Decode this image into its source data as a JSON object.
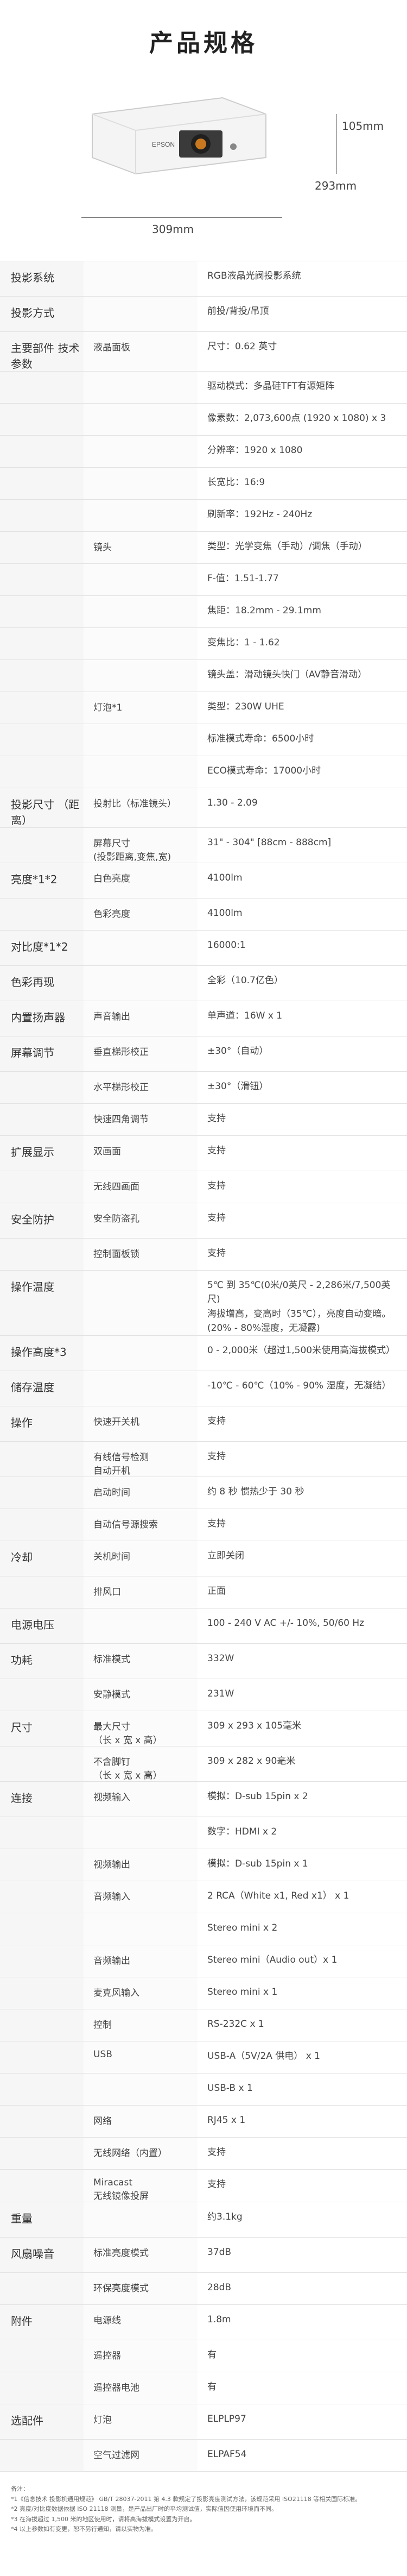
{
  "page_title": "产品规格",
  "brand": "EPSON",
  "dims": {
    "height": "105mm",
    "depth": "293mm",
    "width": "309mm"
  },
  "rows": [
    {
      "cat": "投影系统",
      "sub": "",
      "val": "RGB液晶光阀投影系统"
    },
    {
      "cat": "投影方式",
      "sub": "",
      "val": "前投/背投/吊顶"
    },
    {
      "cat": "主要部件\n技术参数",
      "sub": "液晶面板",
      "val": "尺寸：0.62 英寸"
    },
    {
      "cat": "",
      "sub": "",
      "val": "驱动模式：多晶硅TFT有源矩阵"
    },
    {
      "cat": "",
      "sub": "",
      "val": "像素数：2,073,600点 (1920 x 1080) x 3"
    },
    {
      "cat": "",
      "sub": "",
      "val": "分辨率：1920 x 1080"
    },
    {
      "cat": "",
      "sub": "",
      "val": "长宽比：16:9"
    },
    {
      "cat": "",
      "sub": "",
      "val": "刷新率：192Hz - 240Hz"
    },
    {
      "cat": "",
      "sub": "镜头",
      "val": "类型：光学变焦（手动）/调焦（手动）"
    },
    {
      "cat": "",
      "sub": "",
      "val": "F-值：1.51-1.77"
    },
    {
      "cat": "",
      "sub": "",
      "val": "焦距：18.2mm - 29.1mm"
    },
    {
      "cat": "",
      "sub": "",
      "val": "变焦比：1 - 1.62"
    },
    {
      "cat": "",
      "sub": "",
      "val": "镜头盖：滑动镜头快门（AV静音滑动）"
    },
    {
      "cat": "",
      "sub": "灯泡*1",
      "val": "类型：230W UHE"
    },
    {
      "cat": "",
      "sub": "",
      "val": "标准模式寿命：6500小时"
    },
    {
      "cat": "",
      "sub": "",
      "val": "ECO模式寿命：17000小时"
    },
    {
      "cat": "投影尺寸\n（距离）",
      "sub": "投射比（标准镜头）",
      "val": "1.30 - 2.09"
    },
    {
      "cat": "",
      "sub": "屏幕尺寸\n(投影距离,变焦,宽)",
      "val": "31\" - 304\" [88cm - 888cm]"
    },
    {
      "cat": "亮度*1*2",
      "sub": "白色亮度",
      "val": "4100lm"
    },
    {
      "cat": "",
      "sub": "色彩亮度",
      "val": "4100lm"
    },
    {
      "cat": "对比度*1*2",
      "sub": "",
      "val": "16000:1"
    },
    {
      "cat": "色彩再现",
      "sub": "",
      "val": "全彩（10.7亿色）"
    },
    {
      "cat": "内置扬声器",
      "sub": "声音输出",
      "val": "单声道：16W x 1"
    },
    {
      "cat": "屏幕调节",
      "sub": "垂直梯形校正",
      "val": "±30°（自动）"
    },
    {
      "cat": "",
      "sub": "水平梯形校正",
      "val": "±30°（滑钮）"
    },
    {
      "cat": "",
      "sub": "快速四角调节",
      "val": "支持"
    },
    {
      "cat": "扩展显示",
      "sub": "双画面",
      "val": "支持"
    },
    {
      "cat": "",
      "sub": "无线四画面",
      "val": "支持"
    },
    {
      "cat": "安全防护",
      "sub": "安全防盗孔",
      "val": "支持"
    },
    {
      "cat": "",
      "sub": "控制面板锁",
      "val": "支持"
    },
    {
      "cat": "操作温度",
      "sub": "",
      "val": "5℃ 到 35℃(0米/0英尺 - 2,286米/7,500英尺)\n海拔增高，变高时（35℃），亮度自动变暗。\n(20% - 80%湿度，无凝露)"
    },
    {
      "cat": "操作高度*3",
      "sub": "",
      "val": "0 - 2,000米（超过1,500米使用高海拔模式）"
    },
    {
      "cat": "储存温度",
      "sub": "",
      "val": "-10℃ - 60℃（10% - 90% 湿度，无凝结）"
    },
    {
      "cat": "操作",
      "sub": "快速开关机",
      "val": "支持"
    },
    {
      "cat": "",
      "sub": "有线信号检测\n自动开机",
      "val": "支持"
    },
    {
      "cat": "",
      "sub": "启动时间",
      "val": "约 8 秒 惯热少于 30 秒"
    },
    {
      "cat": "",
      "sub": "自动信号源搜索",
      "val": "支持"
    },
    {
      "cat": "冷却",
      "sub": "关机时间",
      "val": "立即关闭"
    },
    {
      "cat": "",
      "sub": "排风口",
      "val": "正面"
    },
    {
      "cat": "电源电压",
      "sub": "",
      "val": "100 - 240 V AC +/- 10%, 50/60 Hz"
    },
    {
      "cat": "功耗",
      "sub": "标准模式",
      "val": "332W"
    },
    {
      "cat": "",
      "sub": "安静模式",
      "val": "231W"
    },
    {
      "cat": "尺寸",
      "sub": "最大尺寸\n（长 x 宽 x 高）",
      "val": "309 x 293 x 105毫米"
    },
    {
      "cat": "",
      "sub": "不含脚钉\n（长 x 宽 x 高）",
      "val": "309 x 282 x 90毫米"
    },
    {
      "cat": "连接",
      "sub": "视频输入",
      "val": "模拟：D-sub 15pin x 2"
    },
    {
      "cat": "",
      "sub": "",
      "val": "数字：HDMI x 2"
    },
    {
      "cat": "",
      "sub": "视频输出",
      "val": "模拟：D-sub 15pin x 1"
    },
    {
      "cat": "",
      "sub": "音频输入",
      "val": "2 RCA（White x1, Red x1） x 1"
    },
    {
      "cat": "",
      "sub": "",
      "val": "Stereo mini x 2"
    },
    {
      "cat": "",
      "sub": "音频输出",
      "val": "Stereo mini（Audio out）x 1"
    },
    {
      "cat": "",
      "sub": "麦克风输入",
      "val": "Stereo mini x 1"
    },
    {
      "cat": "",
      "sub": "控制",
      "val": "RS-232C x 1"
    },
    {
      "cat": "",
      "sub": "USB",
      "val": "USB-A（5V/2A 供电） x 1"
    },
    {
      "cat": "",
      "sub": "",
      "val": "USB-B x 1"
    },
    {
      "cat": "",
      "sub": "网络",
      "val": "RJ45 x 1"
    },
    {
      "cat": "",
      "sub": "无线网络（内置）",
      "val": "支持"
    },
    {
      "cat": "",
      "sub": "Miracast\n无线镜像投屏",
      "val": "支持"
    },
    {
      "cat": "重量",
      "sub": "",
      "val": "约3.1kg"
    },
    {
      "cat": "风扇噪音",
      "sub": "标准亮度模式",
      "val": "37dB"
    },
    {
      "cat": "",
      "sub": "环保亮度模式",
      "val": "28dB"
    },
    {
      "cat": "附件",
      "sub": "电源线",
      "val": "1.8m"
    },
    {
      "cat": "",
      "sub": "遥控器",
      "val": "有"
    },
    {
      "cat": "",
      "sub": "遥控器电池",
      "val": "有"
    },
    {
      "cat": "选配件",
      "sub": "灯泡",
      "val": "ELPLP97"
    },
    {
      "cat": "",
      "sub": "空气过滤网",
      "val": "ELPAF54"
    }
  ],
  "notes": [
    "备注：",
    "*1《信息技术 投影机通用规范》 GB/T 28037-2011 第 4.3 款规定了投影亮度测试方法，该规范采用 ISO21118 等相关国际标准。",
    "*2 亮度/对比度数据依据 ISO 21118 测量，是产品出厂时的平均测试值，实际值因使用环境而不同。",
    "*3 在海拔超过 1,500 米的地区使用时，请将高海拔模式设置为开启。",
    "*4 以上参数如有变更，恕不另行通知，请以实物为准。"
  ]
}
